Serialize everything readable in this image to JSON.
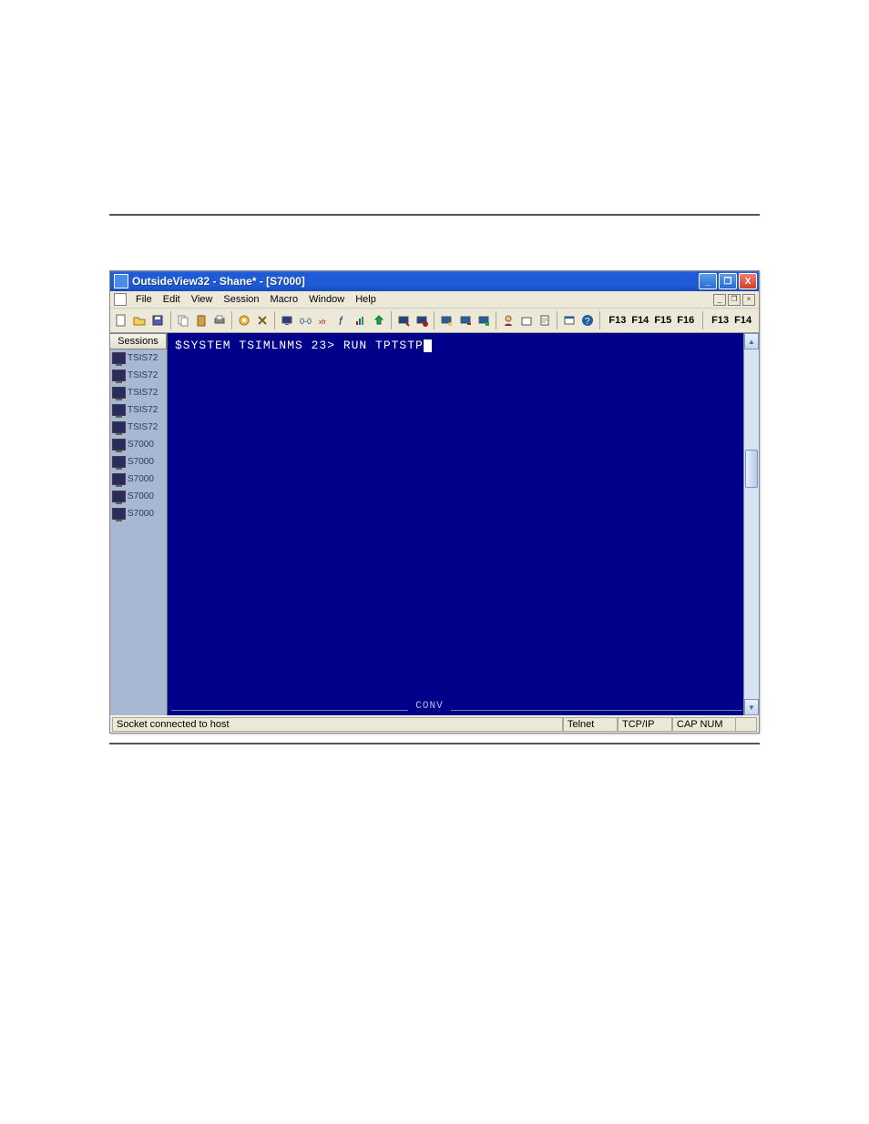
{
  "link_text": "",
  "window": {
    "title": "OutsideView32 - Shane* - [S7000]",
    "buttons": {
      "min": "_",
      "max": "❐",
      "close": "X"
    }
  },
  "menu": {
    "items": [
      "File",
      "Edit",
      "View",
      "Session",
      "Macro",
      "Window",
      "Help"
    ],
    "mdi": {
      "min": "_",
      "restore": "❐",
      "close": "×"
    }
  },
  "toolbar": {
    "icons": [
      "new-icon",
      "open-icon",
      "save-icon",
      "copy-icon",
      "paste-icon",
      "print-icon",
      "settings-icon",
      "tools-icon",
      "screen-icon",
      "binary-icon",
      "transfer-icon",
      "function-icon",
      "chart-icon",
      "upload-icon",
      "record-icon",
      "stop-icon",
      "macro1-icon",
      "macro2-icon",
      "macro3-icon",
      "user-icon",
      "box-icon",
      "doc-icon",
      "window-icon",
      "help-icon"
    ],
    "fkeys1": [
      "F13",
      "F14",
      "F15",
      "F16"
    ],
    "fkeys2": [
      "F13",
      "F14"
    ]
  },
  "sessions": {
    "header": "Sessions",
    "items": [
      "TSIS72",
      "TSIS72",
      "TSIS72",
      "TSIS72",
      "TSIS72",
      "S7000",
      "S7000",
      "S7000",
      "S7000",
      "S7000"
    ]
  },
  "terminal": {
    "prompt": "$SYSTEM TSIMLNMS 23> RUN TPTSTP",
    "conv": "CONV"
  },
  "status": {
    "message": "Socket connected to host",
    "protocol": "Telnet",
    "transport": "TCP/IP",
    "indicators": "CAP  NUM"
  },
  "colors": {
    "terminal_bg": "#00008b",
    "titlebar": "#1f5bd6"
  }
}
